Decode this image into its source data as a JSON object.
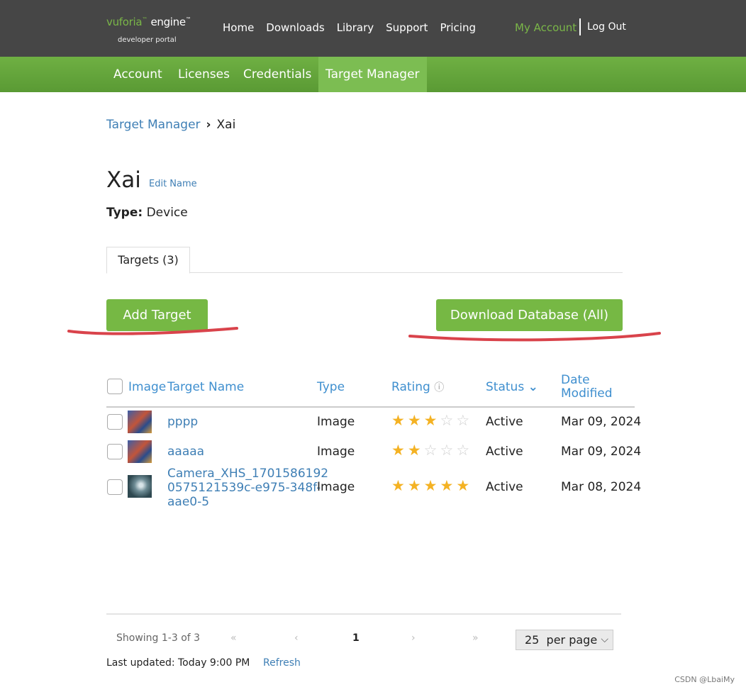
{
  "logo": {
    "brand_a": "vuforia",
    "brand_b": " engine",
    "tm": "™",
    "sub": "developer portal"
  },
  "topnav": [
    "Home",
    "Downloads",
    "Library",
    "Support",
    "Pricing"
  ],
  "account": {
    "my_account": "My Account",
    "logout": "Log Out"
  },
  "subnav": [
    "Account",
    "Licenses",
    "Credentials",
    "Target Manager"
  ],
  "breadcrumb": {
    "root": "Target Manager",
    "sep": "›",
    "current": "Xai"
  },
  "database": {
    "name": "Xai",
    "edit": "Edit Name",
    "type_label": "Type:",
    "type_value": "Device"
  },
  "tab": "Targets (3)",
  "buttons": {
    "add": "Add Target",
    "download": "Download Database (All)"
  },
  "table": {
    "headers": {
      "image": "Image",
      "name": "Target Name",
      "type": "Type",
      "rating": "Rating",
      "rating_icon": "ⓘ",
      "status": "Status",
      "status_icon": "⌄",
      "date": "Date Modified"
    },
    "rows": [
      {
        "name": "pppp",
        "type": "Image",
        "rating": 3,
        "status": "Active",
        "date": "Mar 09, 2024"
      },
      {
        "name": "aaaaa",
        "type": "Image",
        "rating": 2,
        "status": "Active",
        "date": "Mar 09, 2024"
      },
      {
        "name_lines": [
          "Camera_XHS_1701586192",
          "0575121539c-e975-348f-",
          "aae0-5"
        ],
        "type": "Image",
        "rating": 5,
        "status": "Active",
        "date": "Mar 08, 2024"
      }
    ]
  },
  "pager": {
    "showing": "Showing 1-3 of 3",
    "first": "«",
    "prev": "‹",
    "page": "1",
    "next": "›",
    "last": "»",
    "per_page": "25  per page",
    "chev": "⌵"
  },
  "footer": {
    "updated": "Last updated: Today 9:00 PM",
    "refresh": "Refresh"
  },
  "watermark": "CSDN @LbaiMy",
  "colors": {
    "accent": "#76b844",
    "link": "#3f7fb5",
    "annotation": "#d9434b",
    "star": "#f4b223"
  }
}
